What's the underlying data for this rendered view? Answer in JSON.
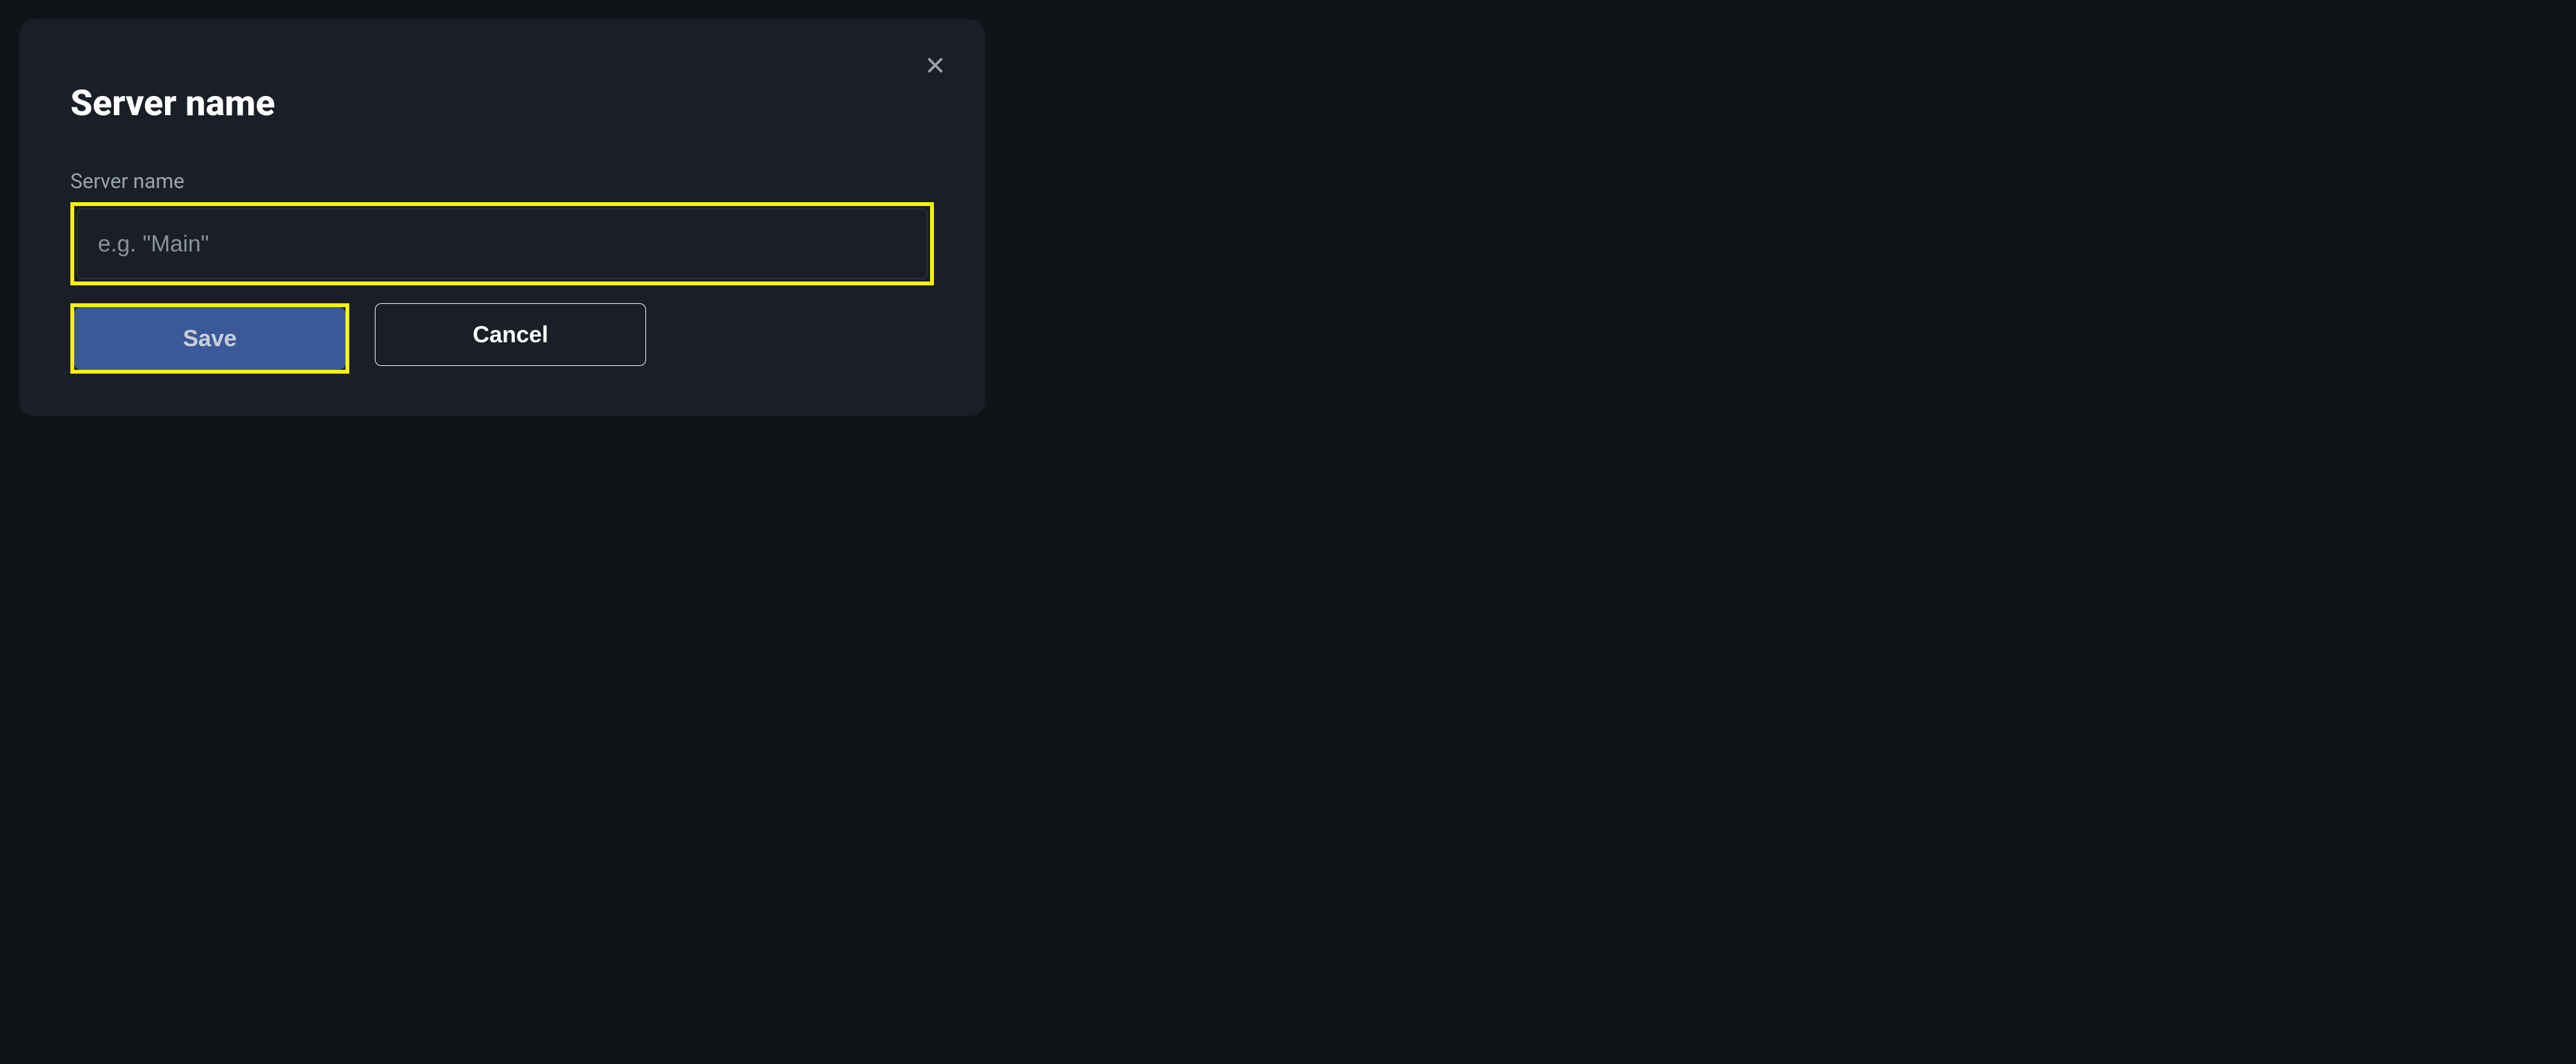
{
  "modal": {
    "title": "Server name",
    "close_icon": "close-icon"
  },
  "form": {
    "server_name": {
      "label": "Server name",
      "placeholder": "e.g. \"Main\"",
      "value": ""
    }
  },
  "buttons": {
    "save_label": "Save",
    "cancel_label": "Cancel"
  },
  "highlights": {
    "input_highlighted": true,
    "save_highlighted": true
  },
  "colors": {
    "highlight": "#f5f500",
    "primary_button": "#3b5998",
    "modal_bg": "#1a1f27",
    "page_bg": "#0f1419",
    "text_muted": "#9ba3af"
  }
}
